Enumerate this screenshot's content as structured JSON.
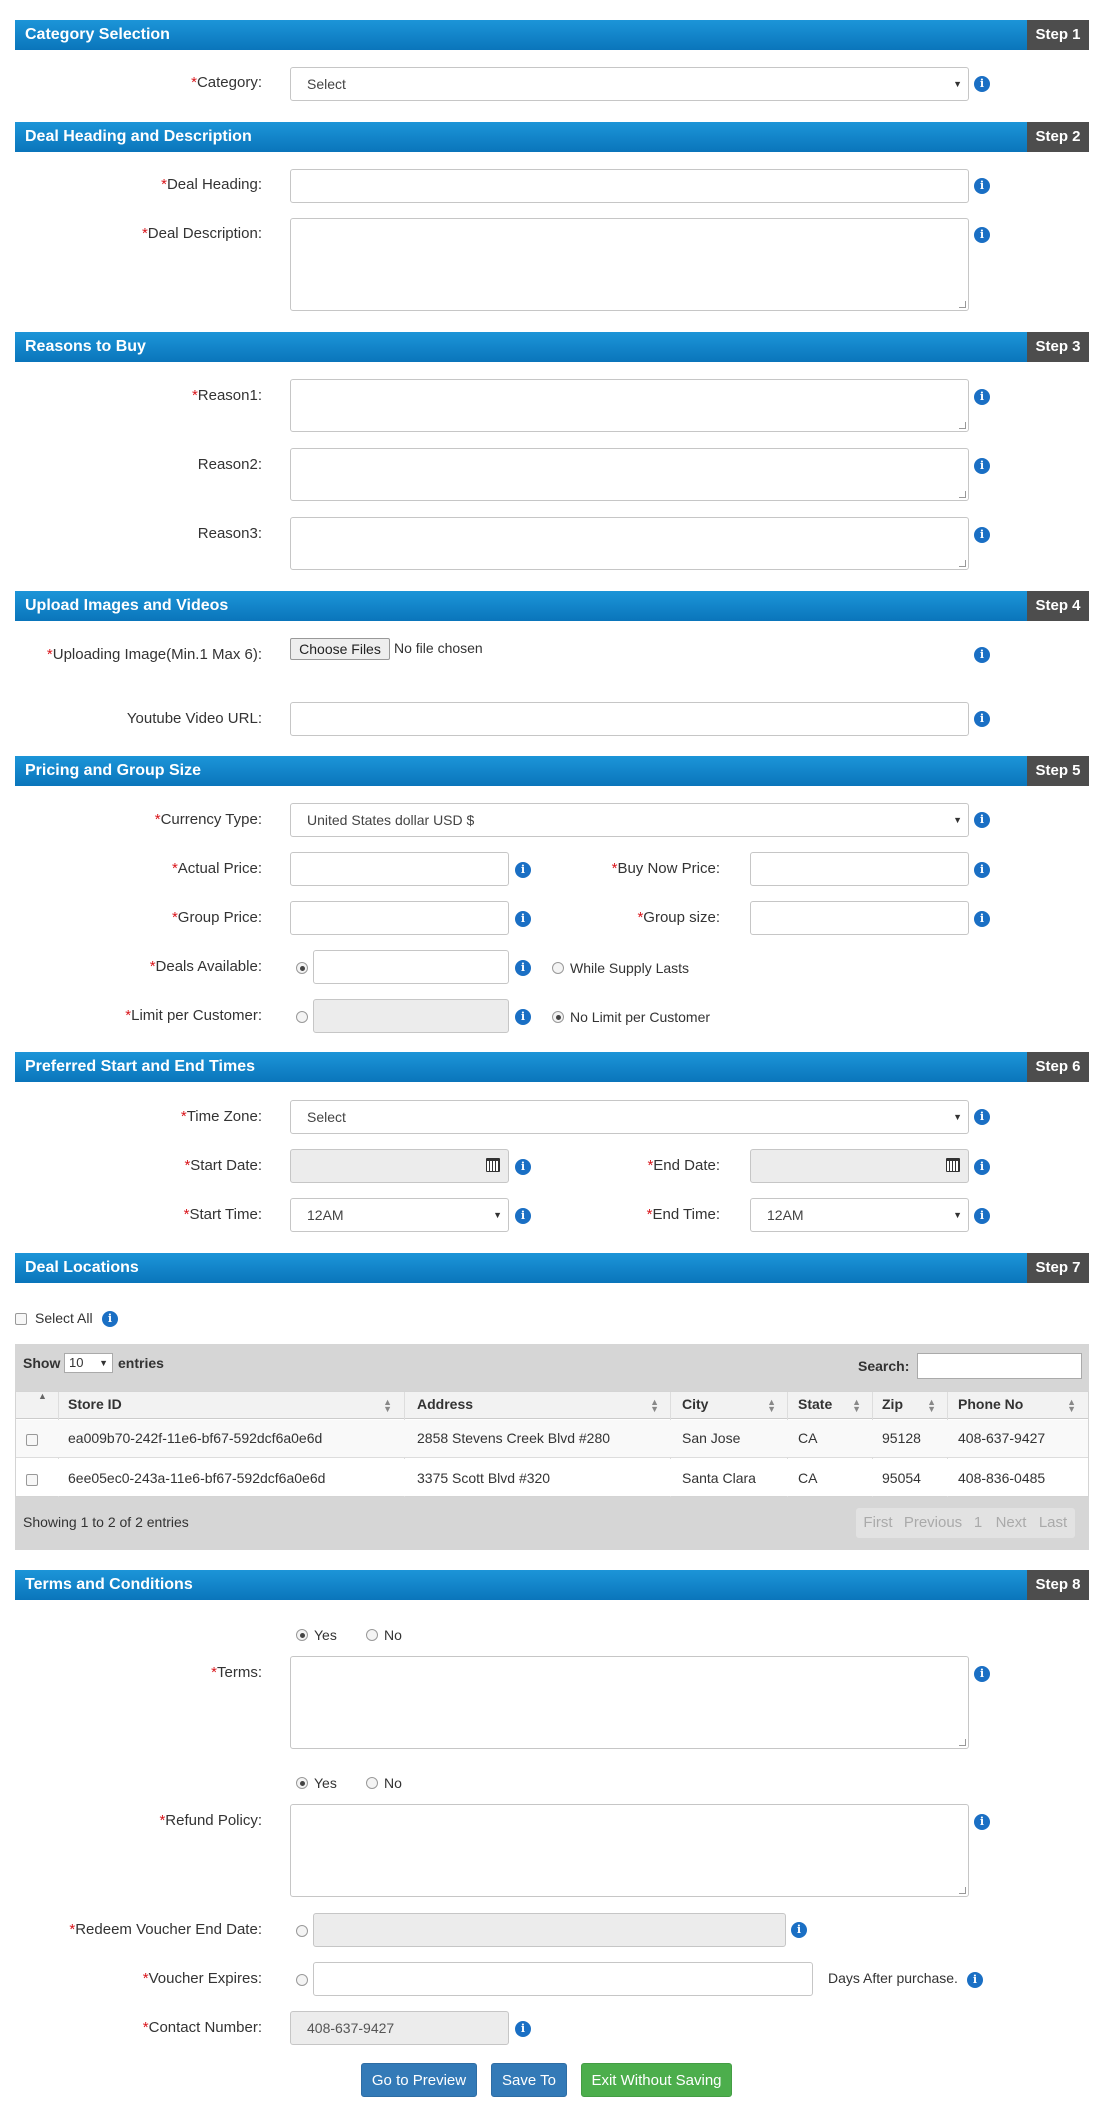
{
  "steps": [
    {
      "title": "Category Selection",
      "step": "Step 1"
    },
    {
      "title": "Deal Heading and Description",
      "step": "Step 2"
    },
    {
      "title": "Reasons to Buy",
      "step": "Step 3"
    },
    {
      "title": "Upload Images and Videos",
      "step": "Step 4"
    },
    {
      "title": "Pricing and Group Size",
      "step": "Step 5"
    },
    {
      "title": "Preferred Start and End Times",
      "step": "Step 6"
    },
    {
      "title": "Deal Locations",
      "step": "Step 7"
    },
    {
      "title": "Terms and Conditions",
      "step": "Step 8"
    }
  ],
  "req": "*",
  "info": "i",
  "category": {
    "label": "Category:",
    "value": "Select"
  },
  "heading": {
    "deal_heading": "Deal Heading:",
    "deal_description": "Deal Description:"
  },
  "reasons": {
    "r1": "Reason1:",
    "r2": "Reason2:",
    "r3": "Reason3:"
  },
  "upload": {
    "label": "Uploading Image(Min.1 Max 6):",
    "button": "Choose Files",
    "status": "No file chosen",
    "youtube": "Youtube Video URL:"
  },
  "pricing": {
    "currency_label": "Currency Type:",
    "currency_value": "United States dollar USD $",
    "actual_price": "Actual Price:",
    "buy_now_price": "Buy Now Price:",
    "group_price": "Group Price:",
    "group_size": "Group size:",
    "deals_available": "Deals Available:",
    "while_supply": "While Supply Lasts",
    "limit_per_customer": "Limit per Customer:",
    "no_limit": "No Limit per Customer"
  },
  "times": {
    "time_zone": "Time Zone:",
    "time_zone_value": "Select",
    "start_date": "Start Date:",
    "end_date": "End Date:",
    "start_time": "Start Time:",
    "start_time_value": "12AM",
    "end_time": "End Time:",
    "end_time_value": "12AM"
  },
  "locations": {
    "select_all": "Select All",
    "show": "Show",
    "entries_value": "10",
    "entries": "entries",
    "search": "Search:",
    "columns": [
      "Store ID",
      "Address",
      "City",
      "State",
      "Zip",
      "Phone No"
    ],
    "rows": [
      [
        "ea009b70-242f-11e6-bf67-592dcf6a0e6d",
        "2858 Stevens Creek Blvd #280",
        "San Jose",
        "CA",
        "95128",
        "408-637-9427"
      ],
      [
        "6ee05ec0-243a-11e6-bf67-592dcf6a0e6d",
        "3375 Scott Blvd #320",
        "Santa Clara",
        "CA",
        "95054",
        "408-836-0485"
      ]
    ],
    "summary": "Showing 1 to 2 of 2 entries",
    "pager": [
      "First",
      "Previous",
      "1",
      "Next",
      "Last"
    ]
  },
  "terms": {
    "yes": "Yes",
    "no": "No",
    "terms_label": "Terms:",
    "refund_label": "Refund Policy:",
    "redeem_label": "Redeem Voucher End Date:",
    "voucher_label": "Voucher Expires:",
    "days_after": "Days After purchase.",
    "contact_label": "Contact Number:",
    "contact_value": "408-637-9427"
  },
  "buttons": {
    "preview": "Go to Preview",
    "save": "Save To",
    "exit": "Exit Without Saving"
  }
}
